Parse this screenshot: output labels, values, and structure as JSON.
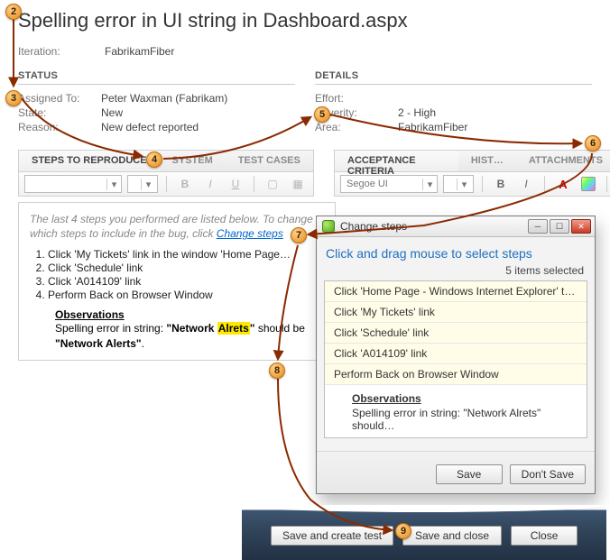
{
  "title": "Spelling error in UI string in Dashboard.aspx",
  "iteration_label": "Iteration:",
  "iteration_value": "FabrikamFiber",
  "status": {
    "heading": "STATUS",
    "assigned_to_label": "Assigned To:",
    "assigned_to_value": "Peter Waxman (Fabrikam)",
    "state_label": "State:",
    "state_value": "New",
    "reason_label": "Reason:",
    "reason_value": "New defect reported"
  },
  "details": {
    "heading": "DETAILS",
    "effort_label": "Effort:",
    "effort_value": "",
    "severity_label": "Severity:",
    "severity_value": "2 - High",
    "area_label": "Area:",
    "area_value": "FabrikamFiber"
  },
  "left_tabs": {
    "steps": "STEPS TO REPRODUCE",
    "system": "SYSTEM",
    "test_cases": "TEST CASES"
  },
  "right_tabs": {
    "acceptance": "ACCEPTANCE CRITERIA",
    "history": "HIST…",
    "attachments": "ATTACHMENTS"
  },
  "left_toolbar": {
    "font_dropdown": "",
    "bold": "B",
    "italic": "I",
    "underline": "U"
  },
  "right_toolbar": {
    "font_dropdown": "Segoe UI",
    "bold": "B",
    "italic": "I",
    "font_color": "A"
  },
  "repro": {
    "hint_prefix": "The last 4 steps you performed are listed below. To change which steps to include in the bug, click ",
    "hint_link": "Change steps",
    "steps": [
      "Click 'My Tickets' link in the window 'Home Page…",
      "Click 'Schedule' link",
      "Click 'A014109' link",
      "Perform Back on Browser Window"
    ],
    "obs_heading": "Observations",
    "obs_text_pre": "Spelling error in string: ",
    "obs_quote_open": "\"Network ",
    "obs_highlight": "Alrets",
    "obs_quote_close": "\"",
    "obs_text_mid": " should be ",
    "obs_correct": "\"Network Alerts\"",
    "obs_period": "."
  },
  "change_steps": {
    "title": "Change steps",
    "hint": "Click and drag mouse to select steps",
    "count": "5 items selected",
    "items": [
      "Click 'Home Page - Windows Internet Explorer' t…",
      "Click 'My Tickets' link",
      "Click 'Schedule' link",
      "Click 'A014109' link",
      "Perform Back on Browser Window"
    ],
    "obs_heading": "Observations",
    "obs_body": "Spelling error in string: \"Network Alrets\" should…",
    "save": "Save",
    "dont_save": "Don't Save"
  },
  "bottom": {
    "save_create": "Save and create test",
    "save_close": "Save and close",
    "close": "Close"
  },
  "callouts": {
    "c2": "2",
    "c3": "3",
    "c4": "4",
    "c5": "5",
    "c6": "6",
    "c7": "7",
    "c8": "8",
    "c9": "9"
  }
}
